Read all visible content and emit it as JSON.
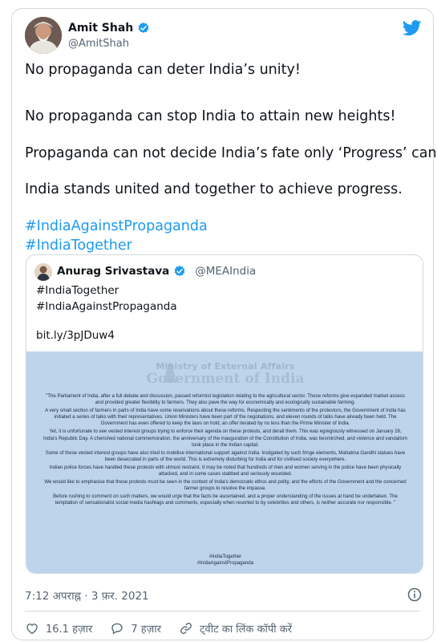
{
  "author": {
    "name": "Amit Shah",
    "handle": "@AmitShah",
    "avatar_icon": "profile-photo"
  },
  "tweet": {
    "lines": [
      "No propaganda can deter India’s unity!",
      "No propaganda can stop India to attain new heights!",
      "Propaganda can not decide India’s fate only ‘Progress’ can.",
      "India stands united and together to achieve progress."
    ],
    "hashtags": [
      "#IndiaAgainstPropaganda",
      "#IndiaTogether"
    ]
  },
  "quoted": {
    "name": "Anurag Srivastava",
    "handle": "@MEAIndia",
    "lines": [
      "#IndiaTogether",
      "#IndiaAgainstPropaganda"
    ],
    "link": "bit.ly/3pJDuw4",
    "image": {
      "ministry": "Ministry of External Affairs",
      "government": "Government of India",
      "paragraphs": [
        "\"The Parliament of India, after a full debate and discussion, passed reformist legislation relating to the agricultural sector. These reforms give expanded market access and provided greater flexibility to farmers. They also pave the way for economically and ecologically sustainable farming.",
        "A very small section of farmers in parts of India have some reservations about these reforms. Respecting the sentiments of the protestors, the Government of India has initiated a series of talks with their representatives. Union Ministers have been part of the negotiations, and eleven rounds of talks have already been held. The Government has even offered to keep the laws on hold, an offer iterated by no less than the Prime Minister of India.",
        "Yet, it is unfortunate to see vested interest groups trying to enforce their agenda on these protests, and derail them. This was egregiously witnessed on January 26, India's Republic Day. A cherished national commemoration, the anniversary of the inauguration of the Constitution of India, was besmirched, and violence and vandalism took place in the Indian capital.",
        "Some of these vested interest groups have also tried to mobilise international support against India. Instigated by such fringe elements, Mahatma Gandhi statues have been desecrated in parts of the world. This is extremely disturbing for India and for civilised society everywhere.",
        "Indian police forces have handled these protests with utmost restraint. It may be noted that hundreds of men and women serving in the police have been physically attacked, and in some cases stabbed and seriously wounded.",
        "We would like to emphasise that these protests must be seen in the context of India's democratic ethos and polity, and the efforts of the Government and the concerned farmer groups to resolve the impasse.",
        "Before rushing to comment on such matters, we would urge that the facts be ascertained, and a proper understanding of the issues at hand be undertaken. The temptation of sensationalist social media hashtags and comments, especially when resorted to by celebrities and others, is neither accurate nor responsible. \""
      ],
      "tags": [
        "#IndiaTogether",
        "#IndiaAgainstPropaganda"
      ]
    }
  },
  "meta": {
    "timestamp": "7:12 अपराह्न · 3 फ़र. 2021"
  },
  "actions": {
    "likes": "16.1 हज़ार",
    "replies": "7 हज़ार",
    "copy_link": "ट्वीट का लिंक कॉपी करें"
  },
  "colors": {
    "accent": "#1d9bf0",
    "secondary_text": "#536471",
    "border": "#cfd9de"
  }
}
